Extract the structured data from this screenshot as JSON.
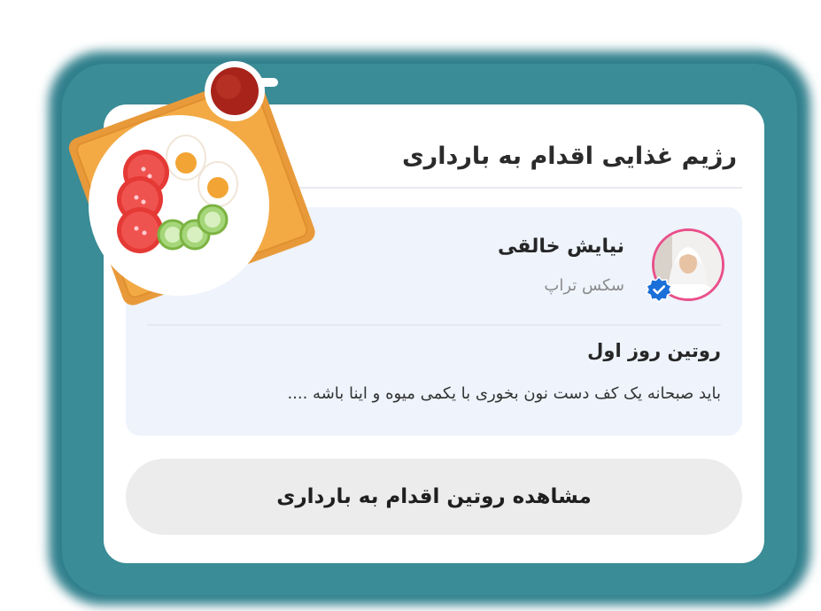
{
  "card": {
    "title": "رژیم غذایی اقدام به بارداری"
  },
  "post": {
    "author_name": "نیایش خالقی",
    "author_role": "سکس تراپ",
    "title": "روتین روز اول",
    "body": "باید صبحانه یک کف دست نون بخوری با یکمی میوه و اینا باشه ...."
  },
  "cta": {
    "label": "مشاهده روتین اقدام به بارداری"
  },
  "colors": {
    "backdrop": "#3a8c96",
    "post_bg": "#eef3fc",
    "avatar_ring": "#e9508a",
    "verified": "#1b6fd8",
    "cta_bg": "#ececec"
  },
  "icons": {
    "verified": "verified-badge-icon",
    "illustration": "breakfast-plate-illustration"
  }
}
